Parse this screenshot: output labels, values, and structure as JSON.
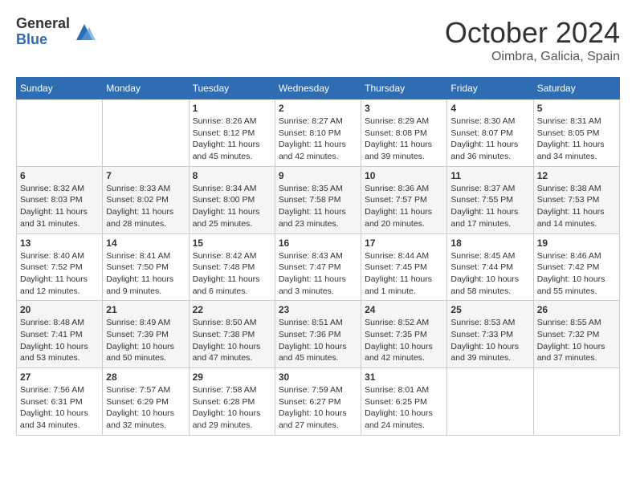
{
  "header": {
    "logo_general": "General",
    "logo_blue": "Blue",
    "month_title": "October 2024",
    "location": "Oimbra, Galicia, Spain"
  },
  "weekdays": [
    "Sunday",
    "Monday",
    "Tuesday",
    "Wednesday",
    "Thursday",
    "Friday",
    "Saturday"
  ],
  "weeks": [
    [
      {
        "day": "",
        "sunrise": "",
        "sunset": "",
        "daylight": ""
      },
      {
        "day": "",
        "sunrise": "",
        "sunset": "",
        "daylight": ""
      },
      {
        "day": "1",
        "sunrise": "Sunrise: 8:26 AM",
        "sunset": "Sunset: 8:12 PM",
        "daylight": "Daylight: 11 hours and 45 minutes."
      },
      {
        "day": "2",
        "sunrise": "Sunrise: 8:27 AM",
        "sunset": "Sunset: 8:10 PM",
        "daylight": "Daylight: 11 hours and 42 minutes."
      },
      {
        "day": "3",
        "sunrise": "Sunrise: 8:29 AM",
        "sunset": "Sunset: 8:08 PM",
        "daylight": "Daylight: 11 hours and 39 minutes."
      },
      {
        "day": "4",
        "sunrise": "Sunrise: 8:30 AM",
        "sunset": "Sunset: 8:07 PM",
        "daylight": "Daylight: 11 hours and 36 minutes."
      },
      {
        "day": "5",
        "sunrise": "Sunrise: 8:31 AM",
        "sunset": "Sunset: 8:05 PM",
        "daylight": "Daylight: 11 hours and 34 minutes."
      }
    ],
    [
      {
        "day": "6",
        "sunrise": "Sunrise: 8:32 AM",
        "sunset": "Sunset: 8:03 PM",
        "daylight": "Daylight: 11 hours and 31 minutes."
      },
      {
        "day": "7",
        "sunrise": "Sunrise: 8:33 AM",
        "sunset": "Sunset: 8:02 PM",
        "daylight": "Daylight: 11 hours and 28 minutes."
      },
      {
        "day": "8",
        "sunrise": "Sunrise: 8:34 AM",
        "sunset": "Sunset: 8:00 PM",
        "daylight": "Daylight: 11 hours and 25 minutes."
      },
      {
        "day": "9",
        "sunrise": "Sunrise: 8:35 AM",
        "sunset": "Sunset: 7:58 PM",
        "daylight": "Daylight: 11 hours and 23 minutes."
      },
      {
        "day": "10",
        "sunrise": "Sunrise: 8:36 AM",
        "sunset": "Sunset: 7:57 PM",
        "daylight": "Daylight: 11 hours and 20 minutes."
      },
      {
        "day": "11",
        "sunrise": "Sunrise: 8:37 AM",
        "sunset": "Sunset: 7:55 PM",
        "daylight": "Daylight: 11 hours and 17 minutes."
      },
      {
        "day": "12",
        "sunrise": "Sunrise: 8:38 AM",
        "sunset": "Sunset: 7:53 PM",
        "daylight": "Daylight: 11 hours and 14 minutes."
      }
    ],
    [
      {
        "day": "13",
        "sunrise": "Sunrise: 8:40 AM",
        "sunset": "Sunset: 7:52 PM",
        "daylight": "Daylight: 11 hours and 12 minutes."
      },
      {
        "day": "14",
        "sunrise": "Sunrise: 8:41 AM",
        "sunset": "Sunset: 7:50 PM",
        "daylight": "Daylight: 11 hours and 9 minutes."
      },
      {
        "day": "15",
        "sunrise": "Sunrise: 8:42 AM",
        "sunset": "Sunset: 7:48 PM",
        "daylight": "Daylight: 11 hours and 6 minutes."
      },
      {
        "day": "16",
        "sunrise": "Sunrise: 8:43 AM",
        "sunset": "Sunset: 7:47 PM",
        "daylight": "Daylight: 11 hours and 3 minutes."
      },
      {
        "day": "17",
        "sunrise": "Sunrise: 8:44 AM",
        "sunset": "Sunset: 7:45 PM",
        "daylight": "Daylight: 11 hours and 1 minute."
      },
      {
        "day": "18",
        "sunrise": "Sunrise: 8:45 AM",
        "sunset": "Sunset: 7:44 PM",
        "daylight": "Daylight: 10 hours and 58 minutes."
      },
      {
        "day": "19",
        "sunrise": "Sunrise: 8:46 AM",
        "sunset": "Sunset: 7:42 PM",
        "daylight": "Daylight: 10 hours and 55 minutes."
      }
    ],
    [
      {
        "day": "20",
        "sunrise": "Sunrise: 8:48 AM",
        "sunset": "Sunset: 7:41 PM",
        "daylight": "Daylight: 10 hours and 53 minutes."
      },
      {
        "day": "21",
        "sunrise": "Sunrise: 8:49 AM",
        "sunset": "Sunset: 7:39 PM",
        "daylight": "Daylight: 10 hours and 50 minutes."
      },
      {
        "day": "22",
        "sunrise": "Sunrise: 8:50 AM",
        "sunset": "Sunset: 7:38 PM",
        "daylight": "Daylight: 10 hours and 47 minutes."
      },
      {
        "day": "23",
        "sunrise": "Sunrise: 8:51 AM",
        "sunset": "Sunset: 7:36 PM",
        "daylight": "Daylight: 10 hours and 45 minutes."
      },
      {
        "day": "24",
        "sunrise": "Sunrise: 8:52 AM",
        "sunset": "Sunset: 7:35 PM",
        "daylight": "Daylight: 10 hours and 42 minutes."
      },
      {
        "day": "25",
        "sunrise": "Sunrise: 8:53 AM",
        "sunset": "Sunset: 7:33 PM",
        "daylight": "Daylight: 10 hours and 39 minutes."
      },
      {
        "day": "26",
        "sunrise": "Sunrise: 8:55 AM",
        "sunset": "Sunset: 7:32 PM",
        "daylight": "Daylight: 10 hours and 37 minutes."
      }
    ],
    [
      {
        "day": "27",
        "sunrise": "Sunrise: 7:56 AM",
        "sunset": "Sunset: 6:31 PM",
        "daylight": "Daylight: 10 hours and 34 minutes."
      },
      {
        "day": "28",
        "sunrise": "Sunrise: 7:57 AM",
        "sunset": "Sunset: 6:29 PM",
        "daylight": "Daylight: 10 hours and 32 minutes."
      },
      {
        "day": "29",
        "sunrise": "Sunrise: 7:58 AM",
        "sunset": "Sunset: 6:28 PM",
        "daylight": "Daylight: 10 hours and 29 minutes."
      },
      {
        "day": "30",
        "sunrise": "Sunrise: 7:59 AM",
        "sunset": "Sunset: 6:27 PM",
        "daylight": "Daylight: 10 hours and 27 minutes."
      },
      {
        "day": "31",
        "sunrise": "Sunrise: 8:01 AM",
        "sunset": "Sunset: 6:25 PM",
        "daylight": "Daylight: 10 hours and 24 minutes."
      },
      {
        "day": "",
        "sunrise": "",
        "sunset": "",
        "daylight": ""
      },
      {
        "day": "",
        "sunrise": "",
        "sunset": "",
        "daylight": ""
      }
    ]
  ]
}
